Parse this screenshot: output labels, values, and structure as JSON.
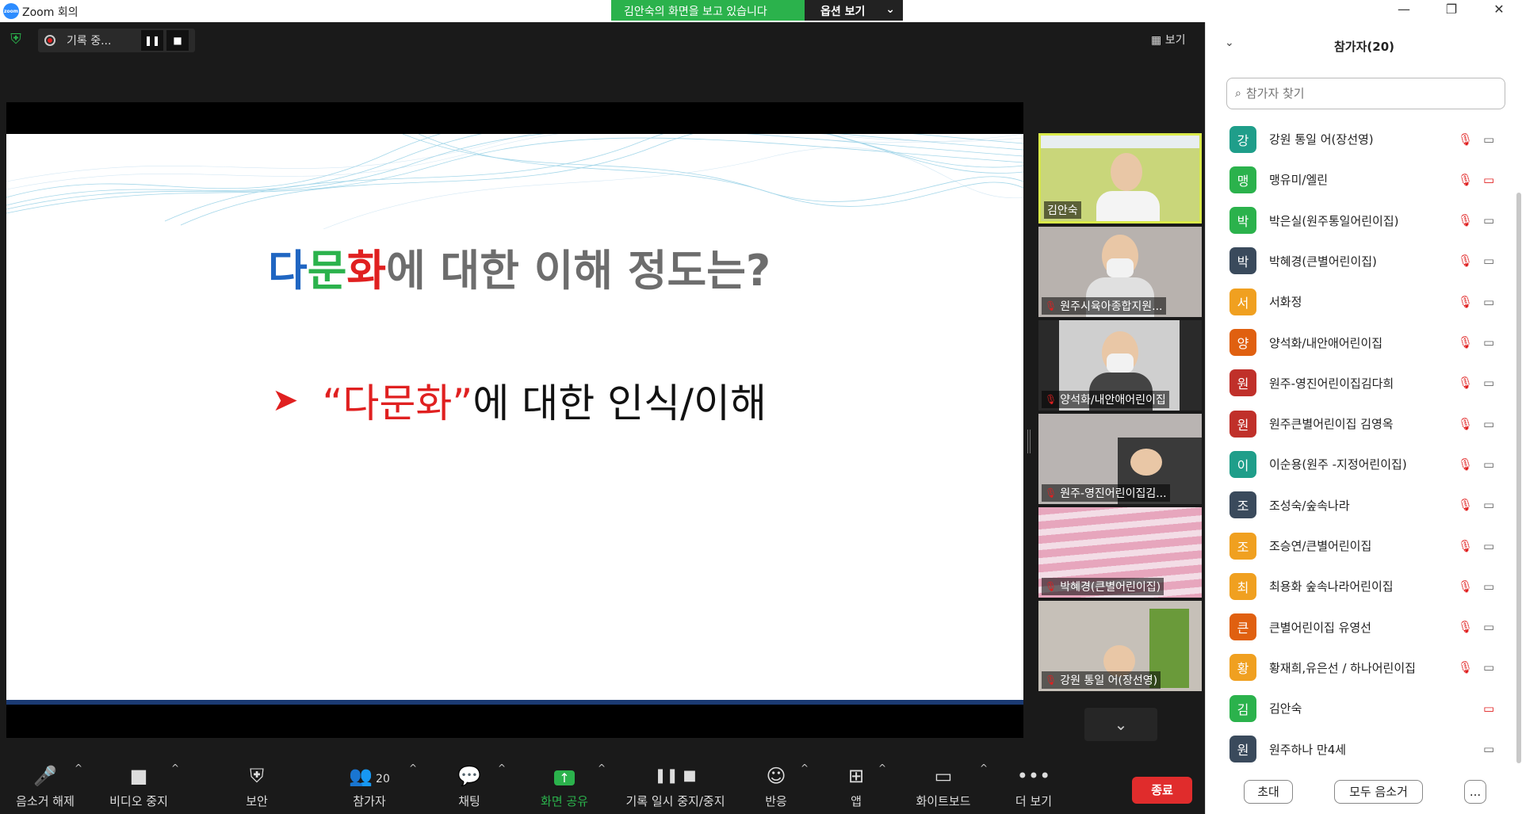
{
  "window": {
    "title": "Zoom 회의",
    "logo_text": "zoom",
    "share_banner": "김안숙의 화면을 보고 있습니다",
    "share_options": "옵션 보기"
  },
  "recording": {
    "label": "기록 중...",
    "pause_icon": "❚❚",
    "stop_icon": "■"
  },
  "view_button": "보기",
  "slide": {
    "title_part1": "다",
    "title_part2": "문",
    "title_part3": "화",
    "title_rest": "에 대한 이해 정도는?",
    "bullet_quoted": "“다문화”",
    "bullet_rest": "에 대한 인식/이해",
    "colors": {
      "blue": "#2066c2",
      "green": "#2bb24c",
      "red": "#e02020"
    }
  },
  "thumbnails": [
    {
      "name": "김안숙",
      "muted": false
    },
    {
      "name": "원주시육아종합지원...",
      "muted": true
    },
    {
      "name": "양석화/내안애어린이집",
      "muted": true
    },
    {
      "name": "원주-영진어린이집김...",
      "muted": true
    },
    {
      "name": "박혜경(큰별어린이집)",
      "muted": true
    },
    {
      "name": "강원 통일 어(장선영)",
      "muted": true
    }
  ],
  "toolbar": {
    "unmute": "음소거 해제",
    "video_stop": "비디오 중지",
    "security": "보안",
    "participants": "참가자",
    "participants_count": "20",
    "chat": "채팅",
    "share": "화면 공유",
    "record_pause": "기록 일시 중지/중지",
    "reactions": "반응",
    "apps": "앱",
    "whiteboard": "화이트보드",
    "more": "더 보기",
    "end": "종료"
  },
  "panel": {
    "title": "참가자(20)",
    "search_placeholder": "참가자 찾기",
    "participants": [
      {
        "initial": "강",
        "name": "강원 통일 어(장선영)",
        "color": "#1f9e8a",
        "mic_off": true,
        "cam_off": false
      },
      {
        "initial": "맹",
        "name": "맹유미/엘린",
        "color": "#2bb24c",
        "mic_off": true,
        "cam_off": true
      },
      {
        "initial": "박",
        "name": "박은실(원주통일어린이집)",
        "color": "#2bb24c",
        "mic_off": true,
        "cam_off": false
      },
      {
        "initial": "박",
        "name": "박혜경(큰별어린이집)",
        "color": "#3a4a5c",
        "mic_off": true,
        "cam_off": false
      },
      {
        "initial": "서",
        "name": "서화정",
        "color": "#f0a020",
        "mic_off": true,
        "cam_off": false
      },
      {
        "initial": "양",
        "name": "양석화/내안애어린이집",
        "color": "#e06010",
        "mic_off": true,
        "cam_off": false
      },
      {
        "initial": "원",
        "name": "원주-영진어린이집김다희",
        "color": "#c0302a",
        "mic_off": true,
        "cam_off": false
      },
      {
        "initial": "원",
        "name": "원주큰별어린이집 김영옥",
        "color": "#c0302a",
        "mic_off": true,
        "cam_off": false
      },
      {
        "initial": "이",
        "name": "이순용(원주 -지정어린이집)",
        "color": "#1f9e8a",
        "mic_off": true,
        "cam_off": false
      },
      {
        "initial": "조",
        "name": "조성숙/숲속나라",
        "color": "#3a4a5c",
        "mic_off": true,
        "cam_off": false
      },
      {
        "initial": "조",
        "name": "조승연/큰별어린이집",
        "color": "#f0a020",
        "mic_off": true,
        "cam_off": false
      },
      {
        "initial": "최",
        "name": "최용화 숲속나라어린이집",
        "color": "#f0a020",
        "mic_off": true,
        "cam_off": false
      },
      {
        "initial": "큰",
        "name": "큰별어린이집 유영선",
        "color": "#e06010",
        "mic_off": true,
        "cam_off": false
      },
      {
        "initial": "황",
        "name": "황재희,유은선 / 하나어린이집",
        "color": "#f0a020",
        "mic_off": true,
        "cam_off": false
      },
      {
        "initial": "김",
        "name": "김안숙",
        "color": "#2bb24c",
        "mic_off": false,
        "cam_off": true
      },
      {
        "initial": "원",
        "name": "원주하나 만4세",
        "color": "#3a4a5c",
        "mic_off": false,
        "cam_off": false
      }
    ],
    "invite": "초대",
    "mute_all": "모두 음소거",
    "more": "..."
  }
}
